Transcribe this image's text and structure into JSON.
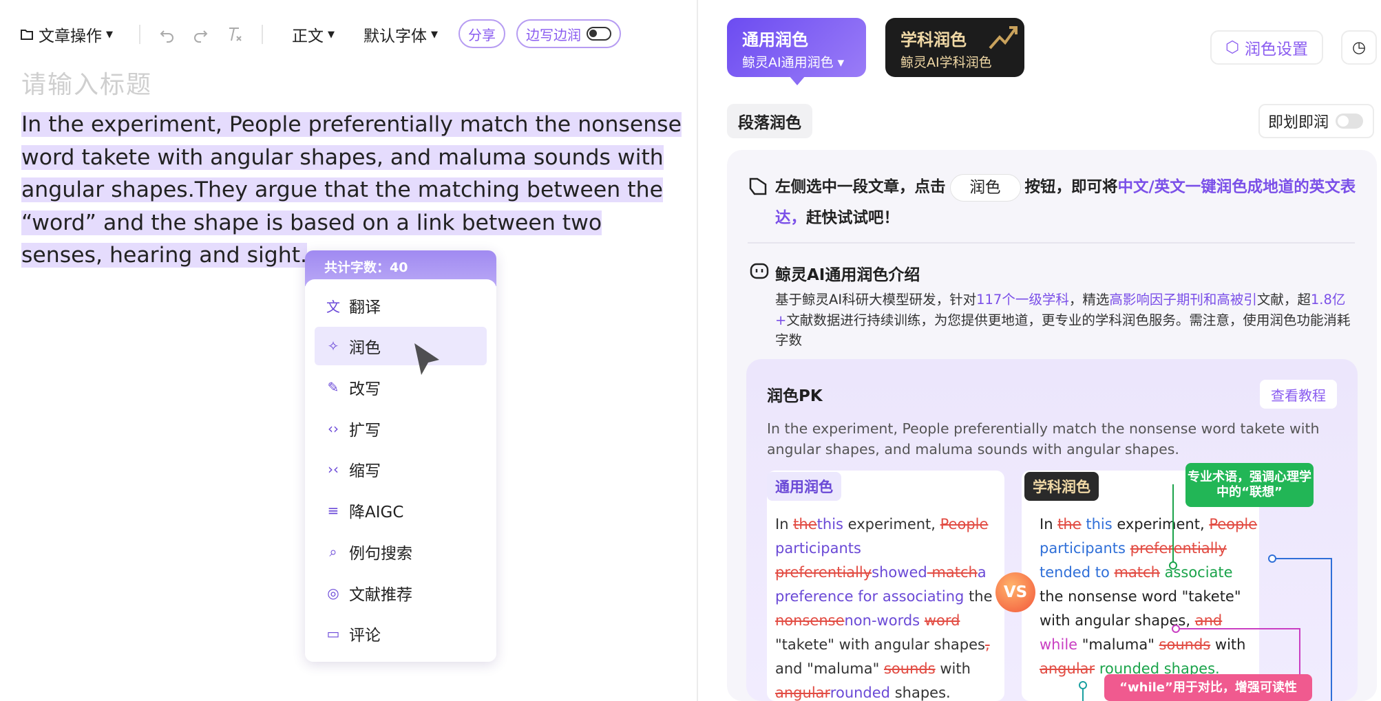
{
  "toolbar": {
    "doc_ops": "文章操作",
    "style": "正文",
    "font": "默认字体",
    "share": "分享",
    "side_edit": "边写边润"
  },
  "editor": {
    "title_placeholder": "请输入标题",
    "lines": [
      "In the experiment,  People preferentially match the nonsense",
      "word takete with angular shapes, and maluma sounds with",
      "angular shapes.They argue that the matching between the",
      "“word” and the shape is based on a link between two",
      "senses, hearing and sight."
    ]
  },
  "popup": {
    "count_label": "共计字数：40",
    "items": [
      {
        "label": "翻译",
        "icon": "translate-icon"
      },
      {
        "label": "润色",
        "icon": "polish-icon"
      },
      {
        "label": "改写",
        "icon": "rewrite-icon"
      },
      {
        "label": "扩写",
        "icon": "expand-icon"
      },
      {
        "label": "缩写",
        "icon": "shrink-icon"
      },
      {
        "label": "降AIGC",
        "icon": "reduce-aigc-icon"
      },
      {
        "label": "例句搜索",
        "icon": "search-icon"
      },
      {
        "label": "文献推荐",
        "icon": "literature-icon"
      },
      {
        "label": "评论",
        "icon": "comment-icon"
      }
    ]
  },
  "right": {
    "tab_general": {
      "title": "通用润色",
      "sub": "鲸灵AI通用润色"
    },
    "tab_subject": {
      "title": "学科润色",
      "sub": "鲸灵AI学科润色"
    },
    "settings": "润色设置",
    "paragraph": "段落润色",
    "instant": "即划即润",
    "tip_pre": "左侧选中一段文章，点击",
    "tip_btn": "润色",
    "tip_mid": "按钮，即可将",
    "tip_hl": "中文/英文一键润色成地道的英文表达，",
    "tip_post": "赶快试试吧！",
    "intro_title": "鲸灵AI通用润色介绍",
    "intro_p1": "基于鲸灵AI科研大模型研发，针对",
    "intro_h1": "117个一级学科",
    "intro_p2": "，精选",
    "intro_h2": "高影响因子期刊和高被引",
    "intro_p3": "文献，超",
    "intro_h3": "1.8亿+",
    "intro_p4": "文献数据进行持续训练，为您提供更地道，更专业的学科润色服务。需注意，使用润色功能消耗字数",
    "pk_title": "润色PK",
    "pk_tutorial": "查看教程",
    "pk_source": "In the experiment,  People preferentially match the nonsense word takete with angular shapes, and maluma sounds with angular shapes.",
    "col_general": "通用润色",
    "col_subject": "学科润色",
    "vs": "VS",
    "note_term": "专业术语，强调心理学中的“联想”",
    "note_while": "“while”用于对比，增强可读性"
  },
  "pk_general_text": [
    [
      "n",
      "In "
    ],
    [
      "d",
      "the"
    ],
    [
      "p",
      "this"
    ],
    [
      "n",
      " experiment, "
    ],
    [
      "d",
      "People"
    ],
    [
      "p",
      " participants "
    ],
    [
      "d",
      "preferentially"
    ],
    [
      "p",
      "showed"
    ],
    [
      "d",
      " match"
    ],
    [
      "p",
      "a preference for associating"
    ],
    [
      "n",
      " the "
    ],
    [
      "d",
      "nonsense"
    ],
    [
      "p",
      "non-words"
    ],
    [
      "n",
      " "
    ],
    [
      "d",
      "word"
    ],
    [
      "n",
      " \"takete\" with angular shapes"
    ],
    [
      "d",
      ","
    ],
    [
      "n",
      " and \"maluma\" "
    ],
    [
      "d",
      "sounds"
    ],
    [
      "n",
      " with "
    ],
    [
      "d",
      "angular"
    ],
    [
      "p",
      "rounded"
    ],
    [
      "n",
      " shapes."
    ]
  ],
  "pk_subject_text": [
    [
      "n",
      "In "
    ],
    [
      "d",
      "the"
    ],
    [
      "b",
      " this"
    ],
    [
      "n",
      " experiment, "
    ],
    [
      "d",
      "People"
    ],
    [
      "b",
      " participants "
    ],
    [
      "d",
      "preferentially"
    ],
    [
      "b",
      " tended to "
    ],
    [
      "d",
      "match"
    ],
    [
      "g",
      " associate"
    ],
    [
      "n",
      " the nonsense word \"takete\" with angular shapes, "
    ],
    [
      "d",
      "and"
    ],
    [
      "m",
      " while"
    ],
    [
      "n",
      " \"maluma\" "
    ],
    [
      "d",
      "sounds"
    ],
    [
      "n",
      " with "
    ],
    [
      "d",
      "angular"
    ],
    [
      "g",
      " rounded shapes."
    ]
  ],
  "colors": {
    "accent": "#7a4fe8",
    "highlight": "#e5dcfd",
    "delete": "#e24c43"
  }
}
